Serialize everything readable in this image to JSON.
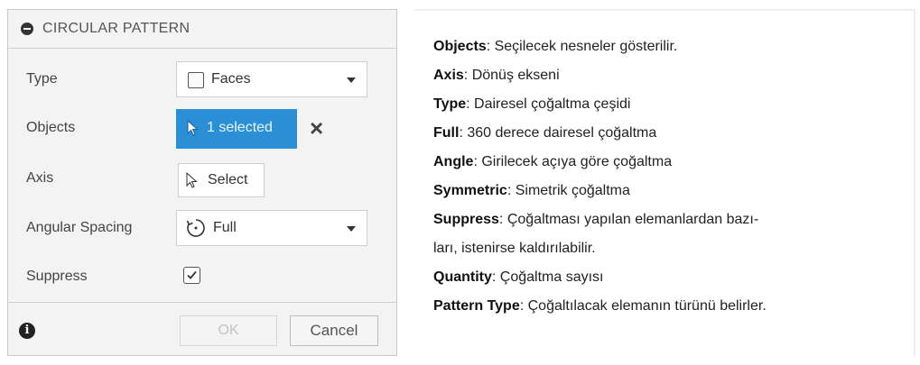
{
  "dialog": {
    "title": "CIRCULAR PATTERN",
    "rows": {
      "type": {
        "label": "Type",
        "value": "Faces"
      },
      "objects": {
        "label": "Objects",
        "value": "1 selected"
      },
      "axis": {
        "label": "Axis",
        "value": "Select"
      },
      "angular_spacing": {
        "label": "Angular Spacing",
        "value": "Full"
      },
      "suppress": {
        "label": "Suppress",
        "checked": true
      }
    },
    "footer": {
      "ok_label": "OK",
      "cancel_label": "Cancel"
    },
    "icons": {
      "collapse": "collapse-icon",
      "faces": "faces-icon",
      "cursor": "cursor-icon",
      "clear": "close-icon",
      "rotate": "rotate-icon",
      "info": "info-icon"
    },
    "colors": {
      "accent": "#2b8fd6"
    }
  },
  "descriptions": [
    {
      "term": "Objects",
      "text": ": Seçilecek nesneler gösterilir."
    },
    {
      "term": "Axis",
      "text": ": Dönüş ekseni"
    },
    {
      "term": "Type",
      "text": ": Dairesel çoğaltma çeşidi"
    },
    {
      "term": "Full",
      "text": ": 360 derece dairesel çoğaltma"
    },
    {
      "term": "Angle",
      "text": ": Girilecek açıya göre çoğaltma"
    },
    {
      "term": "Symmetric",
      "text": ": Simetrik çoğaltma"
    },
    {
      "term": "Suppress",
      "text": ": Çoğaltması yapılan elemanlardan bazı-"
    },
    {
      "term": "",
      "text": "ları, istenirse kaldırılabilir."
    },
    {
      "term": "Quantity",
      "text": ": Çoğaltma sayısı"
    },
    {
      "term": "Pattern Type",
      "text": ": Çoğaltılacak elemanın türünü belirler."
    }
  ]
}
